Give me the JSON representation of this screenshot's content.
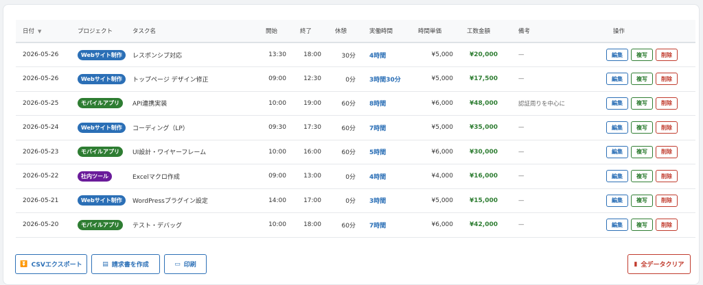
{
  "headers": {
    "date": "日付",
    "project": "プロジェクト",
    "task": "タスク名",
    "start": "開始",
    "end": "終了",
    "break": "休憩",
    "hours": "実働時間",
    "rate": "時間単価",
    "amount": "工数金額",
    "note": "備考",
    "actions": "操作"
  },
  "sort_icon": "▼",
  "colors": {
    "web": "#2b6fb6",
    "mobile": "#2e7d32",
    "internal": "#6a1b9a",
    "edit": "#2b6fb6",
    "copy": "#2e7d32",
    "delete": "#c0392b"
  },
  "row_buttons": {
    "edit": "編集",
    "copy": "複写",
    "delete": "削除"
  },
  "rows": [
    {
      "date": "2026-05-26",
      "project": "Webサイト制作",
      "project_kind": "web",
      "task": "レスポンシブ対応",
      "start": "13:30",
      "end": "18:00",
      "break": "30分",
      "hours": "4時間",
      "rate": "¥5,000",
      "amount": "¥20,000",
      "note": "—"
    },
    {
      "date": "2026-05-26",
      "project": "Webサイト制作",
      "project_kind": "web",
      "task": "トップページ デザイン修正",
      "start": "09:00",
      "end": "12:30",
      "break": "0分",
      "hours": "3時間30分",
      "rate": "¥5,000",
      "amount": "¥17,500",
      "note": "—"
    },
    {
      "date": "2026-05-25",
      "project": "モバイルアプリ",
      "project_kind": "mobile",
      "task": "API連携実装",
      "start": "10:00",
      "end": "19:00",
      "break": "60分",
      "hours": "8時間",
      "rate": "¥6,000",
      "amount": "¥48,000",
      "note": "認証周りを中心に"
    },
    {
      "date": "2026-05-24",
      "project": "Webサイト制作",
      "project_kind": "web",
      "task": "コーディング（LP）",
      "start": "09:30",
      "end": "17:30",
      "break": "60分",
      "hours": "7時間",
      "rate": "¥5,000",
      "amount": "¥35,000",
      "note": "—"
    },
    {
      "date": "2026-05-23",
      "project": "モバイルアプリ",
      "project_kind": "mobile",
      "task": "UI設計・ワイヤーフレーム",
      "start": "10:00",
      "end": "16:00",
      "break": "60分",
      "hours": "5時間",
      "rate": "¥6,000",
      "amount": "¥30,000",
      "note": "—"
    },
    {
      "date": "2026-05-22",
      "project": "社内ツール",
      "project_kind": "internal",
      "task": "Excelマクロ作成",
      "start": "09:00",
      "end": "13:00",
      "break": "0分",
      "hours": "4時間",
      "rate": "¥4,000",
      "amount": "¥16,000",
      "note": "—"
    },
    {
      "date": "2026-05-21",
      "project": "Webサイト制作",
      "project_kind": "web",
      "task": "WordPressプラグイン設定",
      "start": "14:00",
      "end": "17:00",
      "break": "0分",
      "hours": "3時間",
      "rate": "¥5,000",
      "amount": "¥15,000",
      "note": "—"
    },
    {
      "date": "2026-05-20",
      "project": "モバイルアプリ",
      "project_kind": "mobile",
      "task": "テスト・デバッグ",
      "start": "10:00",
      "end": "18:00",
      "break": "60分",
      "hours": "7時間",
      "rate": "¥6,000",
      "amount": "¥42,000",
      "note": "—"
    }
  ],
  "footer": {
    "csv": "CSVエクスポート",
    "invoice": "請求書を作成",
    "print": "印刷",
    "clear_all": "全データクリア"
  }
}
